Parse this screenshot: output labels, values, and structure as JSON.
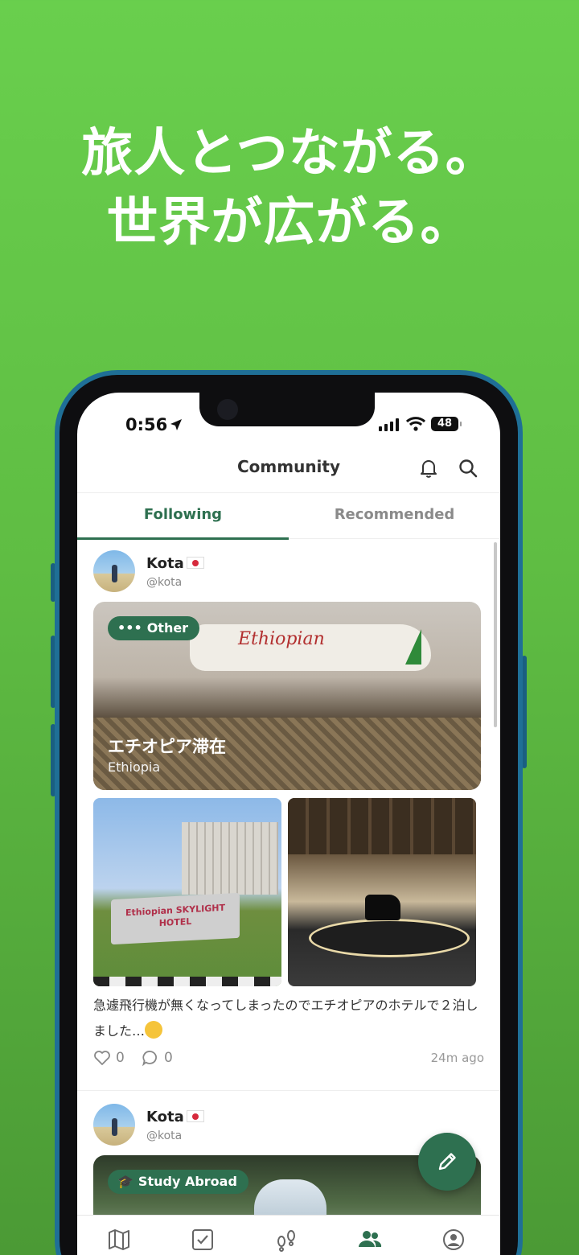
{
  "promo": {
    "line1": "旅人とつながる。",
    "line2": "世界が広がる。"
  },
  "status_bar": {
    "time": "0:56",
    "battery": "48"
  },
  "header": {
    "title": "Community"
  },
  "tabs": [
    {
      "label": "Following"
    },
    {
      "label": "Recommended"
    }
  ],
  "posts": [
    {
      "user": "Kota",
      "handle": "@kota",
      "category": "Other",
      "trip_title": "エチオピア滞在",
      "trip_location": "Ethiopia",
      "airline_text": "Ethiopian",
      "sign_text": "Ethiopian SKYLIGHT HOTEL",
      "text": "急遽飛行機が無くなってしまったのでエチオピアのホテルで２泊しました…",
      "likes": "0",
      "comments": "0",
      "time_ago": "24m ago"
    },
    {
      "user": "Kota",
      "handle": "@kota",
      "category": "Study Abroad"
    }
  ],
  "nav": [
    {
      "icon": "map-icon"
    },
    {
      "icon": "checklist-icon"
    },
    {
      "icon": "footprints-icon"
    },
    {
      "icon": "community-icon",
      "active": true
    },
    {
      "icon": "profile-icon"
    }
  ],
  "colors": {
    "accent": "#2e7050",
    "background": "#5fbd43",
    "inactive_tab": "#8a8a8a"
  }
}
